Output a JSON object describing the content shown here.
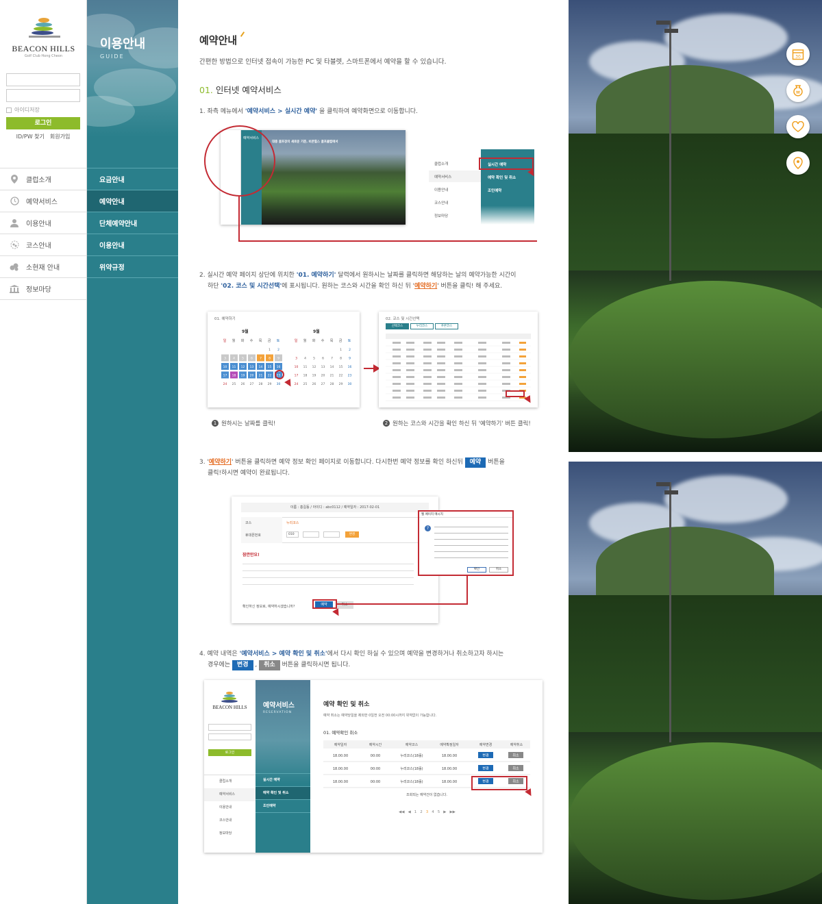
{
  "brand": {
    "name": "BEACON HILLS",
    "sub": "Golf Club Hong Cheon"
  },
  "login": {
    "remember": "아이디저장",
    "button": "로그인",
    "find": "ID/PW 찾기",
    "join": "회원가입"
  },
  "left_nav": [
    {
      "label": "클럽소개",
      "icon": "map-pin-icon"
    },
    {
      "label": "예약서비스",
      "icon": "clock-icon"
    },
    {
      "label": "이용안내",
      "icon": "user-icon"
    },
    {
      "label": "코스안내",
      "icon": "course-icon"
    },
    {
      "label": "소현재 안내",
      "icon": "cluster-icon"
    },
    {
      "label": "정보마당",
      "icon": "building-icon"
    }
  ],
  "sub": {
    "title": "이용안내",
    "en": "GUIDE",
    "items": [
      "요금안내",
      "예약안내",
      "단체예약안내",
      "이용안내",
      "위약규정"
    ]
  },
  "main": {
    "title": "예약안내",
    "desc": "간편한 방법으로 인터넷 접속이 가능한 PC 및 타블렛, 스마트폰에서 예약을 할 수 있습니다.",
    "section_num": "01.",
    "section_title": "인터넷 예약서비스",
    "step1": {
      "a": "1. 좌측 메뉴에서 ",
      "b": "'예약서비스 > 실시간 예약'",
      "c": " 을 클릭하여 예약화면으로 이동합니다."
    },
    "step2": {
      "a": "2. 실시간 예약 페이지 상단에 위치한 ",
      "b": "'01. 예약하기'",
      "c": " 달력에서 원하시는 날짜를 클릭하면 해당하는 날의 예약가능한 시간이",
      "d": "하단 ",
      "e": "'02. 코스 및 시간선택'",
      "f": "에 표시됩니다. 원하는 코스와 시간을 확인 하신 뒤 '",
      "g": "예약하기",
      "h": "' 버튼을 클릭! 해 주세요."
    },
    "step3": {
      "a": "3. '",
      "b": "예약하기",
      "c": "' 버튼을 클릭하면 예약 정보 확인 페이지로 이동합니다. 다시한번 예약 정보를 확인 하신뒤 ",
      "d": "예약",
      "e": " 버튼을",
      "f": "클릭!하시면 예약이 완료됩니다."
    },
    "step4": {
      "a": "4. 예약 내역은 ",
      "b": "'예약서비스 > 예약 확인 및 취소'",
      "c": "에서 다시 확인 하실 수 있으며 예약을 변경하거나 취소하고자 하시는",
      "d": "경우에는 ",
      "e": "변경",
      "f": " , ",
      "g": "취소",
      "h": " 버튼을 클릭하시면 됩니다."
    },
    "caption1": "원하시는 날짜를 클릭!",
    "caption2": "원하는 코스와 시간을 확인 하신 뒤 '예약하기' 버튼 클릭!"
  },
  "shot1": {
    "menu": [
      "클럽소개",
      "예약서비스",
      "이용안내",
      "코스안내",
      "정보마당"
    ],
    "sub": [
      "실시간 예약",
      "예약 확인 및 취소",
      "조인예약"
    ],
    "head": "예약서비스",
    "hero": "대중 골프장의 새로운 기준, 비콘힐스 골프클럽에서"
  },
  "shot2": {
    "cal_title": "01. 예약하기",
    "month1": "9월",
    "month2": "9월",
    "days": [
      "일",
      "월",
      "화",
      "수",
      "목",
      "금",
      "토"
    ],
    "rows1": [
      [
        "",
        "",
        "",
        "",
        "",
        "1",
        "2"
      ],
      [
        "3",
        "4",
        "5",
        "6",
        "7",
        "8",
        "9"
      ],
      [
        "10",
        "11",
        "12",
        "13",
        "14",
        "15",
        "16"
      ],
      [
        "17",
        "18",
        "19",
        "20",
        "21",
        "22",
        "23"
      ],
      [
        "24",
        "25",
        "26",
        "27",
        "28",
        "29",
        "30"
      ]
    ],
    "time_title": "02. 코스 및 시간선택",
    "tabs": [
      "선택코스",
      "누리코스",
      "푸른코스"
    ]
  },
  "shot3": {
    "info": "이름 : 홍길동   /   아이디 : abc0112   /   예약일자 : 2017-02-01",
    "course_label": "코스",
    "course": "누리코스",
    "phone_label": "휴대폰번호",
    "phone": "010",
    "confirm_btn": "변경",
    "notice_title": "잠깐만요!",
    "question": "확인하신 정보로, 예약하시겠습니까?",
    "ok": "예약",
    "cancel": "취소",
    "dialog_title": "웹 페이지 메시지",
    "dialog_ok": "확인",
    "dialog_cancel": "취소"
  },
  "shot4": {
    "sub_title": "예약서비스",
    "sub_en": "RESERVATION",
    "sub_items": [
      "실시간 예약",
      "예약 확인 및 취소",
      "조인예약"
    ],
    "menu": [
      "클럽소개",
      "예약서비스",
      "이용안내",
      "코스안내",
      "정보마당"
    ],
    "title": "예약 확인 및 취소",
    "desc": "예약 취소는 예약당일을 제외한 0일전 오전 00:00시까지 위약없이 가능합니다.",
    "sec": "01. 예약확인 취소",
    "cols": [
      "예약일자",
      "예약시간",
      "예약코스",
      "예약확정일자",
      "예약변경",
      "예약취소"
    ],
    "rows": [
      [
        "18.00.00",
        "00:00",
        "누리코스(18홀)",
        "18.00.00"
      ],
      [
        "18.00.00",
        "00:00",
        "누리코스(18홀)",
        "18.00.00"
      ],
      [
        "18.00.00",
        "00:00",
        "누리코스(18홀)",
        "18.00.00"
      ]
    ],
    "change": "변경",
    "cancel": "취소",
    "empty": "조회되는 예약건이 없습니다.",
    "pages": [
      "1",
      "2",
      "3",
      "4",
      "5"
    ]
  },
  "quick_icons": [
    "calendar-icon",
    "won-icon",
    "heart-icon",
    "location-icon"
  ],
  "quick_calendar": "30",
  "quick_won": "₩"
}
